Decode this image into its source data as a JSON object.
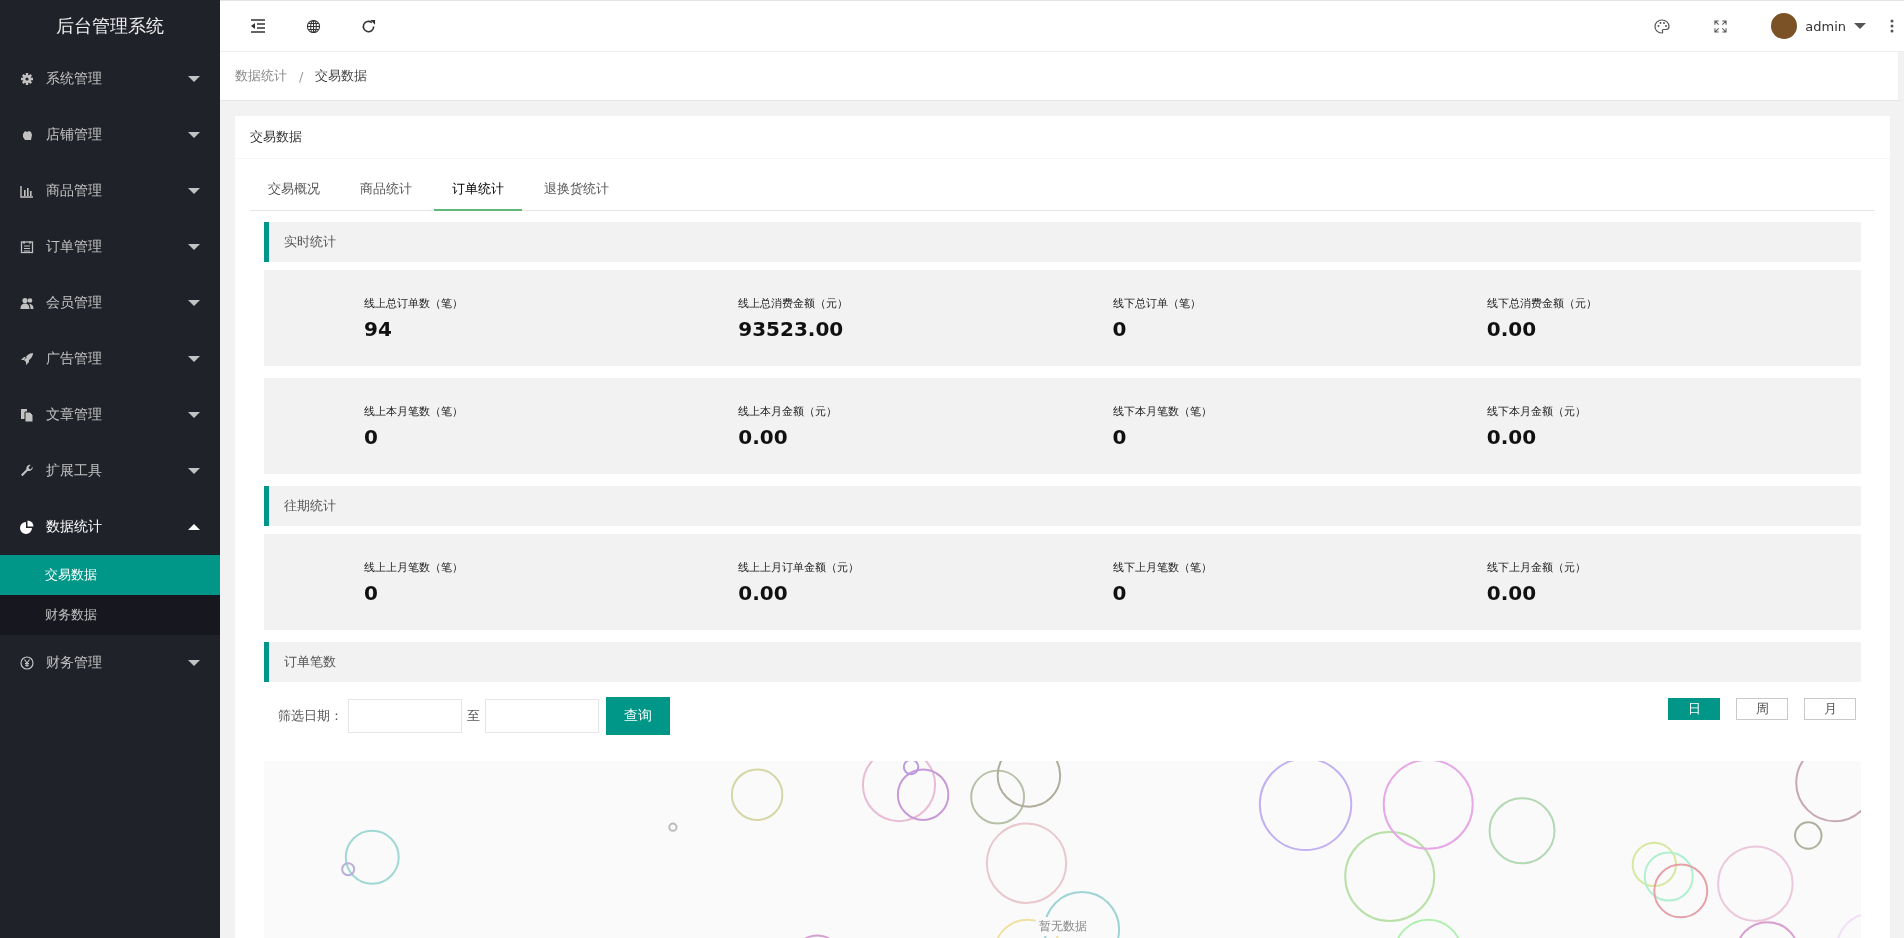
{
  "sidebar": {
    "title": "后台管理系统",
    "items": [
      {
        "label": "系统管理",
        "expanded": false
      },
      {
        "label": "店铺管理",
        "expanded": false
      },
      {
        "label": "商品管理",
        "expanded": false
      },
      {
        "label": "订单管理",
        "expanded": false
      },
      {
        "label": "会员管理",
        "expanded": false
      },
      {
        "label": "广告管理",
        "expanded": false
      },
      {
        "label": "文章管理",
        "expanded": false
      },
      {
        "label": "扩展工具",
        "expanded": false
      },
      {
        "label": "数据统计",
        "expanded": true,
        "children": [
          {
            "label": "交易数据",
            "selected": true
          },
          {
            "label": "财务数据",
            "selected": false
          }
        ]
      },
      {
        "label": "财务管理",
        "expanded": false
      }
    ]
  },
  "top_bar": {
    "user": "admin"
  },
  "breadcrumb": {
    "items": [
      "数据统计",
      "交易数据"
    ],
    "separator": "/"
  },
  "card": {
    "title": "交易数据",
    "tabs": [
      {
        "label": "交易概况",
        "selected": false
      },
      {
        "label": "商品统计",
        "selected": false
      },
      {
        "label": "订单统计",
        "selected": true
      },
      {
        "label": "退换货统计",
        "selected": false
      }
    ],
    "sections": [
      {
        "kind": "stats",
        "title": "实时统计",
        "rows": [
          [
            {
              "label": "线上总订单数（笔）",
              "value": "94"
            },
            {
              "label": "线上总消费金额（元）",
              "value": "93523.00"
            },
            {
              "label": "线下总订单（笔）",
              "value": "0"
            },
            {
              "label": "线下总消费金额（元）",
              "value": "0.00"
            }
          ],
          [
            {
              "label": "线上本月笔数（笔）",
              "value": "0"
            },
            {
              "label": "线上本月金额（元）",
              "value": "0.00"
            },
            {
              "label": "线下本月笔数（笔）",
              "value": "0"
            },
            {
              "label": "线下本月金额（元）",
              "value": "0.00"
            }
          ]
        ]
      },
      {
        "kind": "stats",
        "title": "往期统计",
        "rows": [
          [
            {
              "label": "线上上月笔数（笔）",
              "value": "0"
            },
            {
              "label": "线上上月订单金额（元）",
              "value": "0.00"
            },
            {
              "label": "线下上月笔数（笔）",
              "value": "0"
            },
            {
              "label": "线下上月金额（元）",
              "value": "0.00"
            }
          ]
        ]
      },
      {
        "kind": "chart",
        "title": "订单笔数",
        "filter_label": "筛选日期：",
        "range_word": "至",
        "query_button": "查询",
        "periods": [
          {
            "label": "日",
            "selected": true
          },
          {
            "label": "周",
            "selected": false
          },
          {
            "label": "月",
            "selected": false
          }
        ],
        "empty_text": "暂无数据"
      }
    ]
  }
}
